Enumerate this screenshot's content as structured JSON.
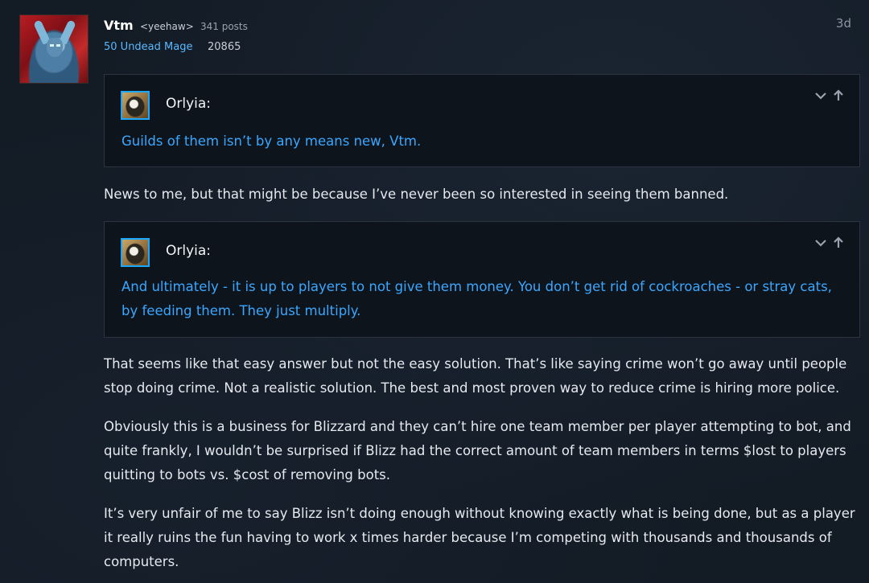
{
  "post": {
    "author": {
      "name": "Vtm",
      "title": "<yeehaw>",
      "post_count": "341 posts",
      "character": "50 Undead Mage",
      "achievement_points": "20865"
    },
    "date": "3d",
    "quotes": [
      {
        "user": "Orlyia:",
        "text": "Guilds of them isn’t by any means new, Vtm."
      },
      {
        "user": "Orlyia:",
        "text": "And ultimately - it is up to players to not give them money. You don’t get rid of cockroaches - or stray cats, by feeding them. They just multiply."
      }
    ],
    "paragraphs": [
      "News to me, but that might be because I’ve never been so interested in seeing them banned.",
      "That seems like that easy answer but not the easy solution. That’s like saying crime won’t go away until people stop doing crime. Not a realistic solution. The best and most proven way to reduce crime is hiring more police.",
      "Obviously this is a business for Blizzard and they can’t hire one team member per player attempting to bot, and quite frankly, I wouldn’t be surprised if Blizz had the correct amount of team members in terms $lost to players quitting to bots vs. $cost of removing bots.",
      "It’s very unfair of me to say Blizz isn’t doing enough without knowing exactly what is being done, but as a player it really ruins the fun having to work x times harder because I’m competing with thousands and thousands of computers."
    ]
  },
  "icons": {
    "expand": "chevron-down-icon",
    "jump": "arrow-up-icon"
  },
  "colors": {
    "background": "#131b25",
    "quote_background": "#0e141c",
    "link_blue": "#3aa7ff",
    "class_blue": "#5bb8ff"
  }
}
